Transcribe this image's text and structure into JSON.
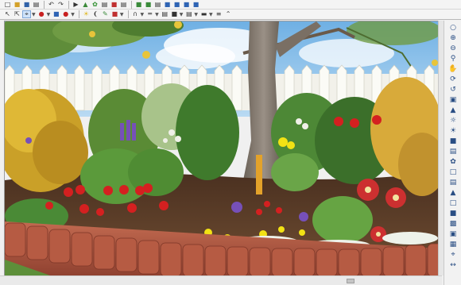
{
  "app": {
    "accent": "#2a6fc9",
    "selection_bg": "#cfe3fa"
  },
  "toolbar_top": {
    "items": [
      "new-file-icon",
      "open-folder-icon",
      "save-icon",
      "print-icon",
      "undo-icon",
      "redo-icon",
      "pointer-icon",
      "select-icon",
      "object-icon",
      "plant-icon",
      "text-icon",
      "shape-icon",
      "color-icon",
      "paint-icon",
      "layer-icon",
      "wall-icon",
      "path-icon",
      "terrain-icon",
      "view-3d-icon",
      "render-icon",
      "walkthrough-icon",
      "help-icon"
    ]
  },
  "toolbar_second": {
    "items": [
      "arrow-icon",
      "select-box-icon",
      "target-icon",
      "record-icon",
      "shapes-icon",
      "fill-icon",
      "lightbulb-icon",
      "eyedropper-icon",
      "brush-icon",
      "bucket-icon",
      "pen-icon",
      "curve-icon",
      "line-icon",
      "wall-tool-icon",
      "fence-icon",
      "block-icon",
      "stairs-icon",
      "dropdown-icon",
      "align-icon",
      "distribute-icon",
      "chevron-up-icon"
    ]
  },
  "sidebar": {
    "items": [
      "zoom-extents-icon",
      "zoom-in-icon",
      "zoom-out-icon",
      "zoom-window-icon",
      "pan-icon",
      "orbit-icon",
      "rotate-icon",
      "camera-icon",
      "walk-icon",
      "light-icon",
      "sun-icon",
      "shadow-icon",
      "layers-icon",
      "plant-view-icon",
      "top-view-icon",
      "side-view-icon",
      "perspective-icon",
      "wireframe-icon",
      "shaded-icon",
      "textured-icon",
      "render-icon",
      "grid-icon",
      "snap-icon",
      "measure-icon"
    ]
  },
  "scene": {
    "description_colors": {
      "sky": "#8fc3ea",
      "fence": "#f4f4ee",
      "edging": "#a8503a",
      "mulch": "#5a3c28",
      "lawn": "#5d8f3a"
    }
  },
  "scrollbar": {
    "position_fraction": 0.79
  }
}
